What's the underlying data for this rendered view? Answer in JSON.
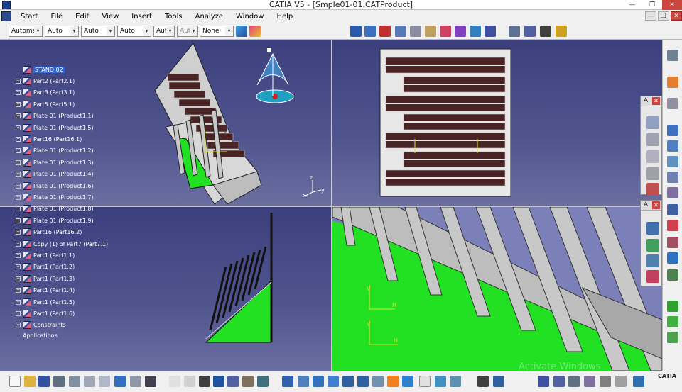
{
  "window": {
    "title": "CATIA V5 - [Smple01-01.CATProduct]"
  },
  "menu": [
    "Start",
    "File",
    "Edit",
    "View",
    "Insert",
    "Tools",
    "Analyze",
    "Window",
    "Help"
  ],
  "toolbar": {
    "combos": [
      "Automa",
      "Auto",
      "Auto",
      "Auto",
      "Aut",
      "Aut",
      "None"
    ]
  },
  "tree": {
    "root": "STAND 02",
    "items": [
      "Part2 (Part2.1)",
      "Part3 (Part3.1)",
      "Part5 (Part5.1)",
      "Plate 01 (Product1.1)",
      "Plate 01 (Product1.5)",
      "Part16 (Part16.1)",
      "Plate 01 (Product1.2)",
      "Plate 01 (Product1.3)",
      "Plate 01 (Product1.4)",
      "Plate 01 (Product1.6)",
      "Plate 01 (Product1.7)",
      "Plate 01 (Product1.8)",
      "Plate 01 (Product1.9)",
      "Part16 (Part16.2)",
      "Copy (1) of Part7 (Part7.1)",
      "Part1 (Part1.1)",
      "Part1 (Part1.2)",
      "Part1 (Part1.3)",
      "Part1 (Part1.4)",
      "Part1 (Part1.5)",
      "Part1 (Part1.6)",
      "Constraints"
    ],
    "applications": "Applications"
  },
  "axis": {
    "x": "x",
    "y": "y",
    "z": "z"
  },
  "labels": {
    "v": "V",
    "h": "H"
  },
  "floating": {
    "a1": "A",
    "a2": "A"
  },
  "watermark": "Activate Windows",
  "logo": "CATIA",
  "colors": {
    "viewport": "#454a85",
    "green": "#22e022",
    "gray": "#c8c8c8",
    "brick": "#4a2424"
  }
}
